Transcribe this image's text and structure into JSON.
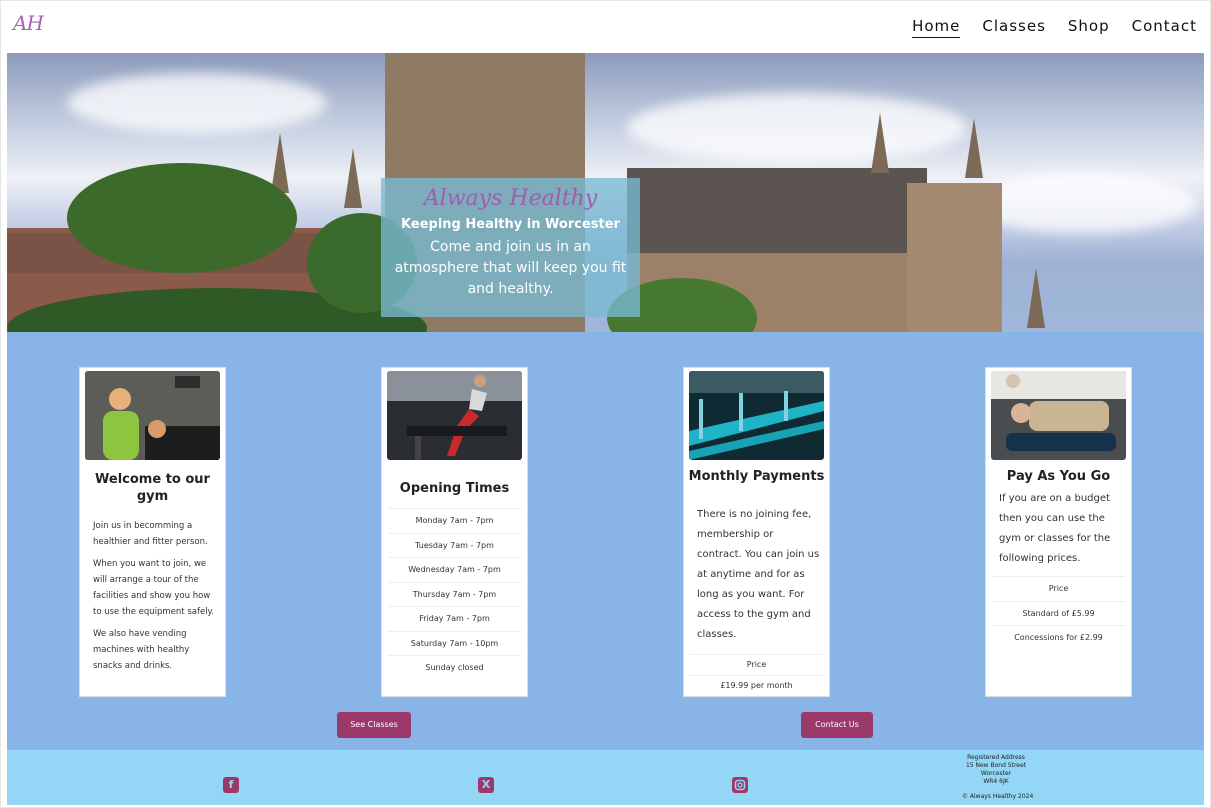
{
  "header": {
    "logo": "AH",
    "nav": [
      "Home",
      "Classes",
      "Shop",
      "Contact"
    ]
  },
  "hero": {
    "script_title": "Always Healthy",
    "subtitle": "Keeping Healthy in Worcester",
    "text": "Come and join us in an atmosphere that will keep you fit and healthy."
  },
  "cards": [
    {
      "title": "Welcome to our gym",
      "paragraphs": [
        "Join us in becomming a healthier and fitter person.",
        "When you want to join, we will arrange a tour of the facilities and show you how to use the equipment safely.",
        "We also have vending machines with healthy snacks and drinks."
      ]
    },
    {
      "title": "Opening Times",
      "rows": [
        "Monday 7am - 7pm",
        "Tuesday 7am - 7pm",
        "Wednesday 7am - 7pm",
        "Thursday 7am - 7pm",
        "Friday 7am - 7pm",
        "Saturday 7am - 10pm",
        "Sunday closed"
      ]
    },
    {
      "title": "Monthly Payments",
      "paragraph": "There is no joining fee, membership or contract. You can join us at anytime and for as long as you want. For access to the gym and classes.",
      "rows": [
        "Price",
        "£19.99 per month"
      ]
    },
    {
      "title": "Pay As You Go",
      "paragraph": "If you are on a budget then you can use the gym or classes for the following prices.",
      "rows": [
        "Price",
        "Standard of £5.99",
        "Concessions for £2.99"
      ]
    }
  ],
  "buttons": {
    "classes": "See Classes",
    "contact": "Contact Us"
  },
  "footer": {
    "social_icons": [
      "facebook-icon",
      "x-twitter-icon",
      "instagram-icon"
    ],
    "address": [
      "Registered Address",
      "15 New Bond Street",
      "Worcester",
      "WR4 6JK"
    ],
    "copyright": "© Always Healthy 2024"
  },
  "colors": {
    "accent": "#9b3a6a",
    "main_bg": "#88b4e7",
    "footer_bg": "#93d6f5",
    "logo": "#a564b4"
  }
}
